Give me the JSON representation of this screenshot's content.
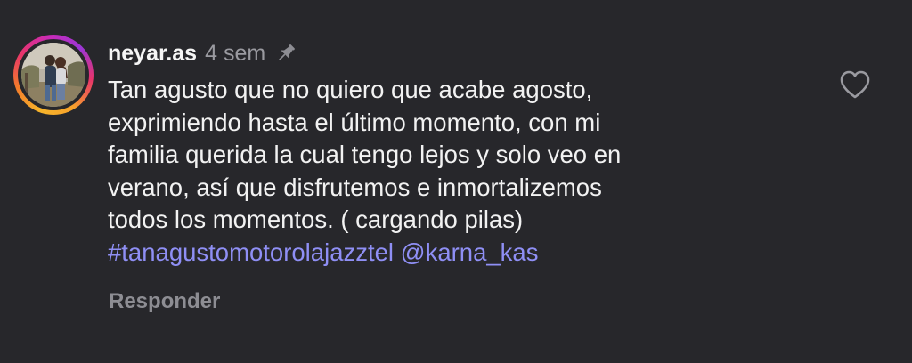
{
  "comment": {
    "username": "neyar.as",
    "time": "4 sem",
    "pin_icon": "pin-icon",
    "avatar_icon": "avatar",
    "text_lines": [
      "Tan agusto que no quiero que acabe agosto,",
      "exprimiendo hasta el último momento, con mi",
      "familia querida la cual tengo lejos y solo veo en",
      "verano, así que disfrutemos e inmortalizemos",
      "todos los momentos. ( cargando pilas)"
    ],
    "hashtag": "#tanagustomotorolajazztel",
    "mention": "@karna_kas",
    "reply_label": "Responder",
    "like_icon": "heart-icon"
  },
  "colors": {
    "background": "#27272b",
    "text": "#f2f2f2",
    "muted": "#9a9aa0",
    "link": "#8f8ff5"
  }
}
